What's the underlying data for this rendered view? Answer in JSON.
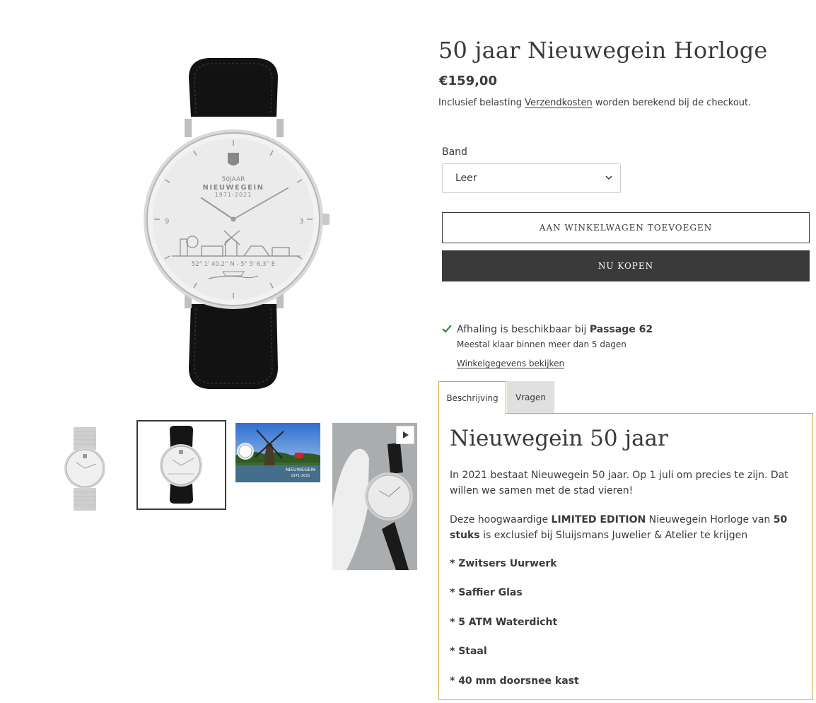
{
  "product": {
    "title": "50 jaar Nieuwegein Horloge",
    "price": "€159,00",
    "tax_prefix": "Inclusief belasting",
    "shipping_link": "Verzendkosten",
    "tax_suffix": "worden berekend bij de checkout."
  },
  "watch_dial": {
    "anniversary": "50JAAR",
    "city": "NIEUWEGEIN",
    "years": "1971-2021",
    "coords": "52° 1' 40.2'' N - 5° 5' 6.3'' E",
    "nine": "9",
    "three": "3"
  },
  "thumbnails": [
    {
      "alt": "mesh-band-watch"
    },
    {
      "alt": "leather-band-watch",
      "selected": true
    },
    {
      "alt": "windmill-photo",
      "caption_city": "NIEUWEGEIN",
      "caption_years": "1971-2021"
    },
    {
      "alt": "video-watch-in-hand",
      "is_video": true
    }
  ],
  "variant": {
    "label": "Band",
    "selected": "Leer"
  },
  "buttons": {
    "add_to_cart": "AAN WINKELWAGEN TOEVOEGEN",
    "buy_now": "NU KOPEN"
  },
  "pickup": {
    "text": "Afhaling is beschikbaar bij",
    "location": "Passage 62",
    "sub": "Meestal klaar binnen meer dan 5 dagen",
    "link": "Winkelgegevens bekijken"
  },
  "tabs": [
    {
      "label": "Beschrijving",
      "active": true
    },
    {
      "label": "Vragen",
      "active": false
    }
  ],
  "description": {
    "title": "Nieuwegein 50 jaar",
    "p1": "In 2021 bestaat Nieuwegein 50 jaar. Op 1 juli om precies te zijn. Dat willen we samen met de stad vieren!",
    "p2_a": "Deze hoogwaardige ",
    "p2_b": "LIMITED EDITION",
    "p2_c": " Nieuwegein Horloge van ",
    "p2_d": "50 stuks",
    "p2_e": " is exclusief bij Sluijsmans Juwelier & Atelier te krijgen",
    "features": [
      "* Zwitsers Uurwerk",
      "* Saffier Glas",
      "* 5 ATM Waterdicht",
      "* Staal",
      "* 40 mm doorsnee kast"
    ]
  },
  "colors": {
    "text": "#3a3a3a",
    "accent_border": "#d9a441",
    "check": "#2e8b3a",
    "tab_inactive": "#e0e0e0"
  }
}
